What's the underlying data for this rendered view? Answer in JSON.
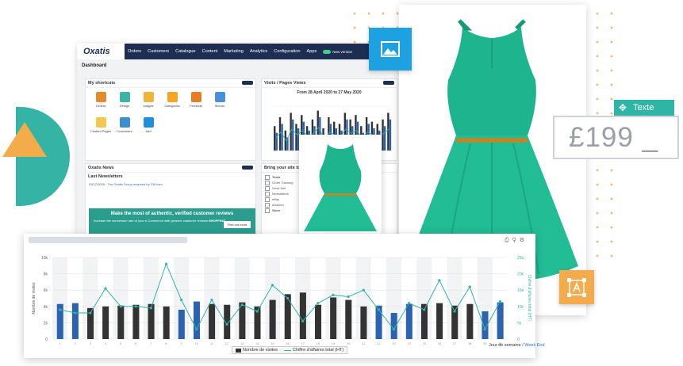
{
  "colors": {
    "nav": "#1e2d52",
    "teal": "#2eb5a6",
    "blue_bar": "#2b63b1",
    "dark_bar": "#333333",
    "orange": "#f4ab4b",
    "sky": "#1da1e0"
  },
  "backoffice": {
    "logo": "Oxatis",
    "nav": [
      "Orders",
      "Customers",
      "Catalogue",
      "Content",
      "Marketing",
      "Analytics",
      "Configuration",
      "Apps"
    ],
    "toggle_label": "New version",
    "page_title": "Dashboard",
    "shortcuts": {
      "title": "My shortcuts",
      "items": [
        {
          "label": "Orders",
          "icon": "cart-icon",
          "color": "#e68a2e"
        },
        {
          "label": "Design",
          "icon": "palette-icon",
          "color": "#3bb4a4"
        },
        {
          "label": "Images",
          "icon": "image-icon",
          "color": "#f0b43a"
        },
        {
          "label": "Categories",
          "icon": "folder-icon",
          "color": "#f5a623"
        },
        {
          "label": "Products",
          "icon": "tag-icon",
          "color": "#e57e25"
        },
        {
          "label": "Menus",
          "icon": "menu-icon",
          "color": "#4a90d9"
        },
        {
          "label": "Custom Pages",
          "icon": "pencil-icon",
          "color": "#f2c94c"
        },
        {
          "label": "Customers",
          "icon": "users-icon",
          "color": "#3a8fd0"
        },
        {
          "label": "Add",
          "icon": "plus-icon",
          "color": "#1e8fd8"
        }
      ]
    },
    "visits": {
      "title": "Visits / Pages Views",
      "range": "From 28 April 2020 to 27 May 2020"
    },
    "news": {
      "title": "Oxatis News",
      "subtitle": "Last Newsletters",
      "item_date": "03/27/2020 :",
      "item_text": "The Oxatis Group acquired by CM.com",
      "promo_title": "Make the most of authentic, verified customer reviews",
      "promo_text": "Increase the conversion rate of your e-Commerce with genuine customer reviews",
      "promo_brand": "SHOPPING",
      "promo_button": "Find out more"
    },
    "bring": {
      "title": "Bring your site to life",
      "group1": "Tools",
      "items1": [
        "Order Tracking",
        "Send Sell",
        "Newsletters",
        "eBay",
        "Amazon"
      ],
      "group2": "Store"
    }
  },
  "price_widget": {
    "tag_label": "Texte",
    "price": "£199 _",
    "move_icon": "move-icon"
  },
  "badges": {
    "image": "image-icon",
    "text": "text-frame-icon"
  },
  "big_chart_ui": {
    "tools": [
      "print-icon",
      "zoom-icon",
      "settings-icon"
    ],
    "legend_bars": "Nombre de visites",
    "legend_line": "Chiffre d'affaires total (HT)",
    "x_title": "Jour de semaine",
    "x_title_link": "Week End",
    "y_left": "Nombre de visites",
    "y_right": "Chiffre d'affaires total (HT)"
  },
  "chart_data": [
    {
      "type": "bar",
      "title": "",
      "y_ticks": [
        "10k",
        "8k",
        "6k",
        "4k",
        "2k",
        "0"
      ],
      "y2_ticks": [
        "25k",
        "20k",
        "15k",
        "10k",
        "5k",
        "0"
      ],
      "ylim": [
        0,
        10000
      ],
      "y2lim": [
        0,
        25000
      ],
      "categories": [
        "1",
        "2",
        "3",
        "4",
        "5",
        "6",
        "7",
        "8",
        "9",
        "10",
        "11",
        "12",
        "13",
        "14",
        "15",
        "16",
        "17",
        "18",
        "19",
        "20",
        "21",
        "22",
        "23",
        "24",
        "25",
        "26",
        "27",
        "28",
        "29",
        "30"
      ],
      "series": [
        {
          "name": "Nombre de visites",
          "kind": "bar",
          "values": [
            4300,
            4400,
            3800,
            4000,
            4100,
            4200,
            4300,
            4000,
            3600,
            4600,
            4300,
            4200,
            4500,
            4000,
            4800,
            5500,
            5700,
            4200,
            5100,
            4800,
            4000,
            4100,
            3200,
            4300,
            4300,
            4400,
            4100,
            4300,
            3400,
            4500
          ],
          "highlight": [
            0,
            1,
            8,
            9,
            21,
            22,
            23,
            28,
            29
          ]
        },
        {
          "name": "Chiffre d'affaires total (HT)",
          "kind": "line",
          "values": [
            9000,
            8000,
            8000,
            15500,
            10000,
            10000,
            9500,
            23000,
            12000,
            3000,
            12000,
            4500,
            10500,
            8500,
            16500,
            12500,
            5500,
            11000,
            13500,
            13000,
            15000,
            9000,
            3000,
            11000,
            9000,
            18000,
            8500,
            16000,
            3000,
            11500
          ]
        }
      ]
    },
    {
      "type": "bar",
      "title": "From 28 April 2020 to 27 May 2020",
      "series": [
        {
          "name": "Visits",
          "values": [
            40,
            60,
            30,
            70,
            50,
            65,
            45,
            55,
            75,
            35,
            60,
            50,
            45,
            70,
            55,
            65,
            40,
            60,
            50,
            45,
            55,
            70
          ]
        },
        {
          "name": "Page Views",
          "values": [
            55,
            75,
            45,
            85,
            60,
            80,
            55,
            70,
            90,
            50,
            75,
            65,
            60,
            85,
            70,
            80,
            55,
            75,
            65,
            60,
            70,
            85
          ]
        }
      ]
    }
  ]
}
